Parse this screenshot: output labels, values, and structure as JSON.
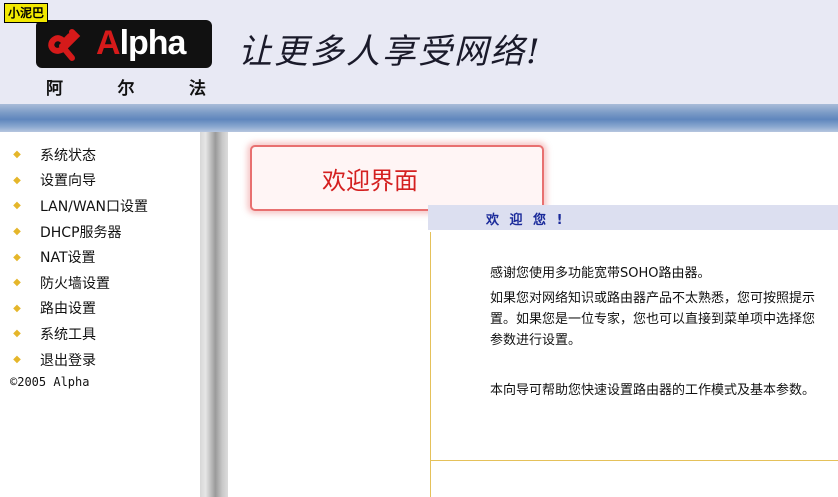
{
  "watermark": "小泥巴",
  "brand": {
    "logo_text_first": "A",
    "logo_text_rest": "lpha",
    "logo_chars": [
      "阿",
      "尔",
      "法"
    ],
    "slogan": "让更多人享受网络!"
  },
  "sidebar": {
    "items": [
      {
        "label": "系统状态"
      },
      {
        "label": "设置向导"
      },
      {
        "label": "LAN/WAN口设置"
      },
      {
        "label": "DHCP服务器"
      },
      {
        "label": "NAT设置"
      },
      {
        "label": "防火墙设置"
      },
      {
        "label": "路由设置"
      },
      {
        "label": "系统工具"
      },
      {
        "label": "退出登录"
      }
    ],
    "bullet": "◆",
    "copyright": "©2005 Alpha"
  },
  "main": {
    "callout": "欢迎界面",
    "panel_title": "欢 迎 您 !",
    "lines": [
      "感谢您使用多功能宽带SOHO路由器。",
      "如果您对网络知识或路由器产品不太熟悉，您可按照提示",
      "置。如果您是一位专家，您也可以直接到菜单项中选择您",
      "参数进行设置。",
      "本向导可帮助您快速设置路由器的工作模式及基本参数。"
    ]
  },
  "colors": {
    "accent_red": "#d42020",
    "title_blue": "#1a2a9a",
    "bullet_gold": "#e5b62a",
    "band_blue": "#5f86bd"
  }
}
